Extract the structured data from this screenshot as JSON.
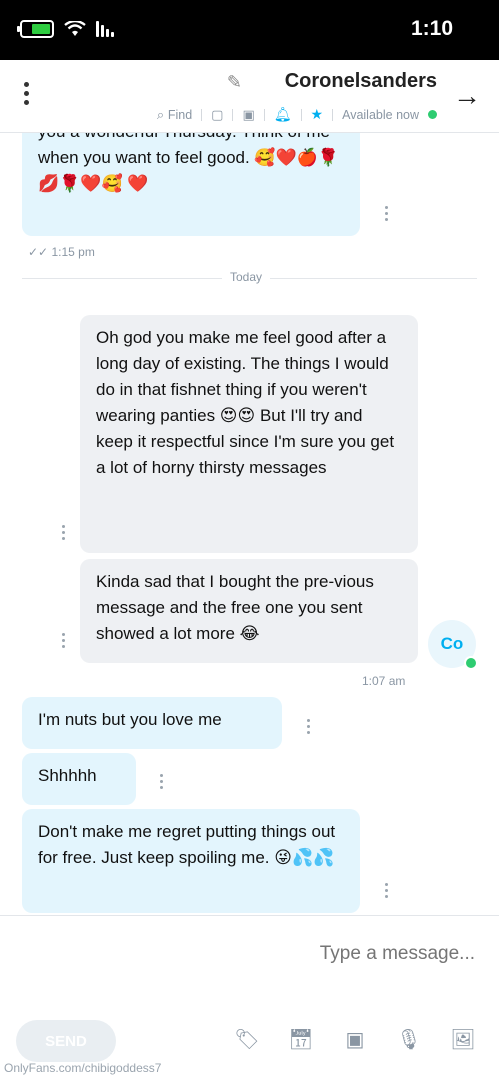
{
  "status_bar": {
    "time": "1:10"
  },
  "header": {
    "contact_name": "Coronelsanders",
    "status": "Available now",
    "find_label": "Find"
  },
  "messages": [
    {
      "id": "m1",
      "direction": "out",
      "text": "you a wonderful Thursday. Think of me when you want to feel good. 🥰❤️🍎🌹💋🌹❤️🥰 ❤️",
      "time": "1:15 pm"
    },
    {
      "id": "m2",
      "direction": "in",
      "text": "Oh god you make me feel good after a long day of existing. The things I would do in that fishnet thing if you weren't wearing panties 😍😍 But I'll try and keep it respectful since I'm sure you get a lot of horny thirsty messages"
    },
    {
      "id": "m3",
      "direction": "in",
      "text": "Kinda sad that I bought the pre-vious message and the free one you sent showed a lot more 😂",
      "time": "1:07 am"
    },
    {
      "id": "m4",
      "direction": "out",
      "text": "I'm nuts but you love me"
    },
    {
      "id": "m5",
      "direction": "out",
      "text": "Shhhhh"
    },
    {
      "id": "m6",
      "direction": "out",
      "text": "Don't make me regret putting things out for free. Just keep spoiling me. 😜💦💦"
    }
  ],
  "day_divider": "Today",
  "avatar_initials": "Co",
  "composer": {
    "placeholder": "Type a message...",
    "send_label": "SEND"
  },
  "watermark": "OnlyFans.com/chibigoddess7",
  "colors": {
    "accent": "#00aff0",
    "outgoing_bubble": "#e3f5fd",
    "incoming_bubble": "#eef0f3",
    "online": "#2ecc71"
  }
}
